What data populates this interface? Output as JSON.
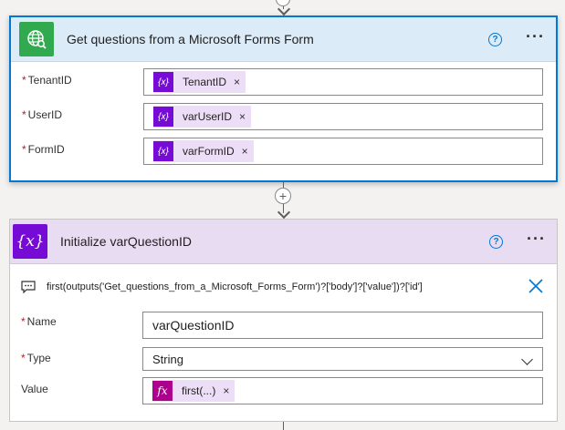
{
  "card1": {
    "title": "Get questions from a Microsoft Forms Form",
    "help": "?",
    "more": "···",
    "fields": [
      {
        "label": "TenantID",
        "required": true,
        "token": "TenantID",
        "token_icon": "{x}"
      },
      {
        "label": "UserID",
        "required": true,
        "token": "varUserID",
        "token_icon": "{x}"
      },
      {
        "label": "FormID",
        "required": true,
        "token": "varFormID",
        "token_icon": "{x}"
      }
    ],
    "token_remove": "×"
  },
  "add_step": "+",
  "card2": {
    "title": "Initialize varQuestionID",
    "header_icon": "{x}",
    "help": "?",
    "more": "···",
    "comment": "first(outputs('Get_questions_from_a_Microsoft_Forms_Form')?['body']?['value'])?['id']",
    "fields": {
      "name": {
        "label": "Name",
        "required": true,
        "value": "varQuestionID"
      },
      "type": {
        "label": "Type",
        "required": true,
        "value": "String"
      },
      "value": {
        "label": "Value",
        "required": false,
        "token": "first(...)",
        "token_icon": "fx"
      }
    },
    "token_remove": "×"
  },
  "required_marker": "*",
  "colors": {
    "accent": "#0078d4",
    "forms_green": "#31a94f",
    "variable_purple": "#770bd6",
    "expression_magenta": "#ad008c"
  }
}
